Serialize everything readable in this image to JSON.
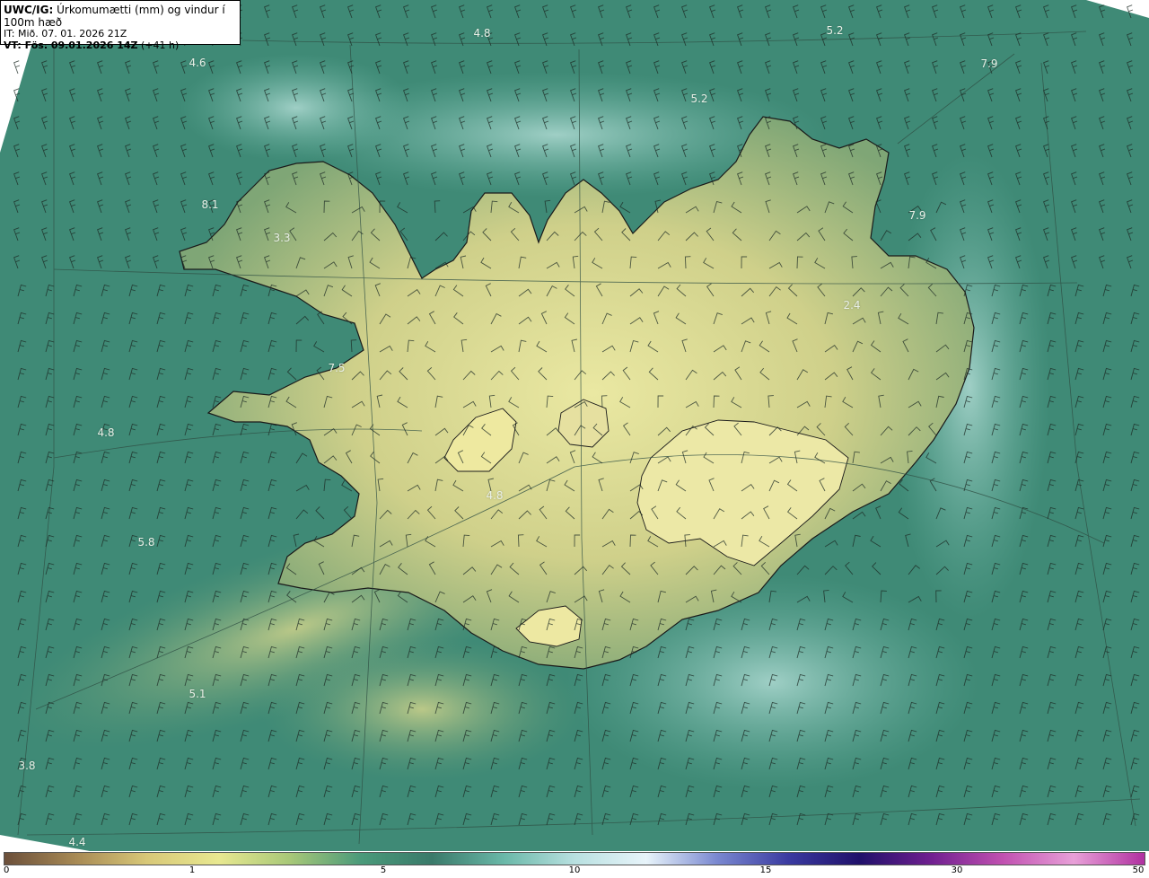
{
  "header": {
    "line1_bold": "UWC/IG:",
    "line1_text": "Úrkomumætti (mm) og vindur í 100m hæð",
    "line2_text": "IT: Mið. 07. 01. 2026 21Z",
    "line3_bold": "VT: Fös. 09.01.2026 14Z",
    "line3_text": "(+41 h)"
  },
  "map_labels": [
    "4.8",
    "5.2",
    "4.6",
    "7.9",
    "5.2",
    "8.1",
    "3.3",
    "7.9",
    "2.4",
    "7.5",
    "4.8",
    "4.8",
    "5.8",
    "5.1",
    "3.8",
    "4.4"
  ],
  "colorbar": {
    "ticks": [
      "0",
      "1",
      "5",
      "10",
      "15",
      "30",
      "50"
    ],
    "colors": [
      "#6b4f3a",
      "#a88a55",
      "#d8c878",
      "#e8e890",
      "#a8c878",
      "#4a9a7a",
      "#3a7a6a",
      "#6ab8a8",
      "#b8e0e0",
      "#e8f4fa",
      "#7a88d0",
      "#3a3aa0",
      "#20106a",
      "#702090",
      "#c050b0",
      "#e8a0d8",
      "#b030a0"
    ]
  },
  "colors": {
    "sea": "#3f8a76",
    "land_low": "#8fb07a",
    "land_high": "#e8e6a0",
    "coast": "#1a1a1a"
  }
}
